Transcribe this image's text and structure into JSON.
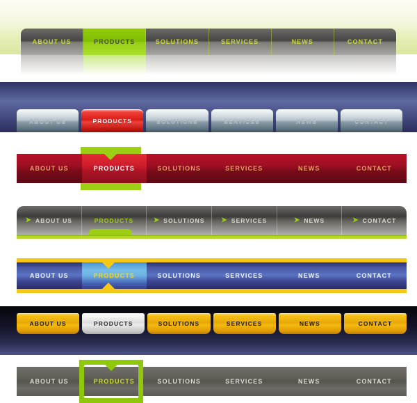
{
  "menu_labels": [
    "ABOUT US",
    "PRODUCTS",
    "SOLUTIONS",
    "SERVICES",
    "NEWS",
    "CONTACT"
  ],
  "active_label": "PRODUCTS",
  "bars": [
    {
      "id": "bar1",
      "name": "green-page-grey-tab-navbar",
      "style_note": "grey glossy tabs on pale green background, green active tab, mirrored reflection",
      "colors": {
        "background": "#e5eeb4",
        "item_bg": "#484644",
        "item_text": "#c6d92c",
        "active_bg": "#7fbd03",
        "active_text": "#4c4a47"
      },
      "items": [
        {
          "label": "ABOUT US",
          "active": false
        },
        {
          "label": "PRODUCTS",
          "active": true
        },
        {
          "label": "SOLUTIONS",
          "active": false
        },
        {
          "label": "SERVICES",
          "active": false
        },
        {
          "label": "NEWS",
          "active": false
        },
        {
          "label": "CONTACT",
          "active": false
        }
      ]
    },
    {
      "id": "bar2",
      "name": "navy-metallic-button-navbar",
      "style_note": "silver metallic rounded buttons on dark navy gradient panel, red active button",
      "colors": {
        "background": "#5e6aa0",
        "item_bg": "#b9c6cd",
        "item_text": "#a9b4bd",
        "active_bg": "#d81d18",
        "active_text": "#ffffff"
      },
      "items": [
        {
          "label": "ABOUT US",
          "active": false
        },
        {
          "label": "PRODUCTS",
          "active": true
        },
        {
          "label": "SOLUTIONS",
          "active": false
        },
        {
          "label": "SERVICES",
          "active": false
        },
        {
          "label": "NEWS",
          "active": false
        },
        {
          "label": "CONTACT",
          "active": false
        }
      ]
    },
    {
      "id": "bar3",
      "name": "red-bar-green-accent-navbar",
      "style_note": "deep red gradient bar, lighter red active cell framed by green strips above and below with a downward notch",
      "colors": {
        "background": "#9c0f22",
        "item_text": "#e0a15e",
        "active_bg": "#cf1d2c",
        "active_text": "#ffffff",
        "accent": "#9ccf14"
      },
      "items": [
        {
          "label": "ABOUT US",
          "active": false
        },
        {
          "label": "PRODUCTS",
          "active": true
        },
        {
          "label": "SOLUTIONS",
          "active": false
        },
        {
          "label": "SERVICES",
          "active": false
        },
        {
          "label": "NEWS",
          "active": false
        },
        {
          "label": "CONTACT",
          "active": false
        }
      ]
    },
    {
      "id": "bar4",
      "name": "grey-arrow-bullet-navbar",
      "style_note": "grey gradient bar, green arrow bullet before each label, green underline rail and green pill tab under active item",
      "bullet_icon": "arrow-right-icon",
      "bullet_glyph": "➤",
      "colors": {
        "background": "#3e3c3a",
        "item_text": "#d9d9d2",
        "active_text": "#9ccf14",
        "accent": "#9ccf14",
        "underline": "#b8d827"
      },
      "items": [
        {
          "label": "ABOUT US",
          "active": false,
          "bullet": true
        },
        {
          "label": "PRODUCTS",
          "active": true,
          "bullet": false
        },
        {
          "label": "SOLUTIONS",
          "active": false,
          "bullet": true
        },
        {
          "label": "SERVICES",
          "active": false,
          "bullet": true
        },
        {
          "label": "NEWS",
          "active": false,
          "bullet": true
        },
        {
          "label": "CONTACT",
          "active": false,
          "bullet": true
        }
      ]
    },
    {
      "id": "bar5",
      "name": "blue-gold-rail-navbar",
      "style_note": "blue gradient bar with gold rails top and bottom, light blue active cell, gold triangles pointing in from each rail",
      "colors": {
        "background": "#4a5ba8",
        "item_text": "#eef3fb",
        "active_bg": "#74bde8",
        "active_text": "#f3d61c",
        "rail": "#f5c818"
      },
      "items": [
        {
          "label": "ABOUT US",
          "active": false
        },
        {
          "label": "PRODUCTS",
          "active": true
        },
        {
          "label": "SOLUTIONS",
          "active": false
        },
        {
          "label": "SERVICES",
          "active": false
        },
        {
          "label": "NEWS",
          "active": false
        },
        {
          "label": "CONTACT",
          "active": false
        }
      ]
    },
    {
      "id": "bar6",
      "name": "black-gold-button-navbar",
      "style_note": "gold glossy rounded buttons on near-black navy gradient panel, white silver active button",
      "colors": {
        "background": "#14142a",
        "item_bg": "#e8a705",
        "item_text": "#1b1a14",
        "active_bg": "#dcdcdc",
        "active_text": "#2a2a2a"
      },
      "items": [
        {
          "label": "ABOUT US",
          "active": false
        },
        {
          "label": "PRODUCTS",
          "active": true
        },
        {
          "label": "SOLUTIONS",
          "active": false
        },
        {
          "label": "SERVICES",
          "active": false
        },
        {
          "label": "NEWS",
          "active": false
        },
        {
          "label": "CONTACT",
          "active": false
        }
      ]
    },
    {
      "id": "bar7",
      "name": "grey-green-outline-navbar",
      "style_note": "flat grey gradient bar with thick green outline box around the active item and a notch cut in its top edge",
      "colors": {
        "background": "#56544e",
        "item_text": "#dcdcd4",
        "active_text": "#c9df2b",
        "outline": "#8fc80a"
      },
      "items": [
        {
          "label": "ABOUT US",
          "active": false
        },
        {
          "label": "PRODUCTS",
          "active": true
        },
        {
          "label": "SOLUTIONS",
          "active": false
        },
        {
          "label": "SERVICES",
          "active": false
        },
        {
          "label": "NEWS",
          "active": false
        },
        {
          "label": "CONTACT",
          "active": false
        }
      ]
    }
  ]
}
